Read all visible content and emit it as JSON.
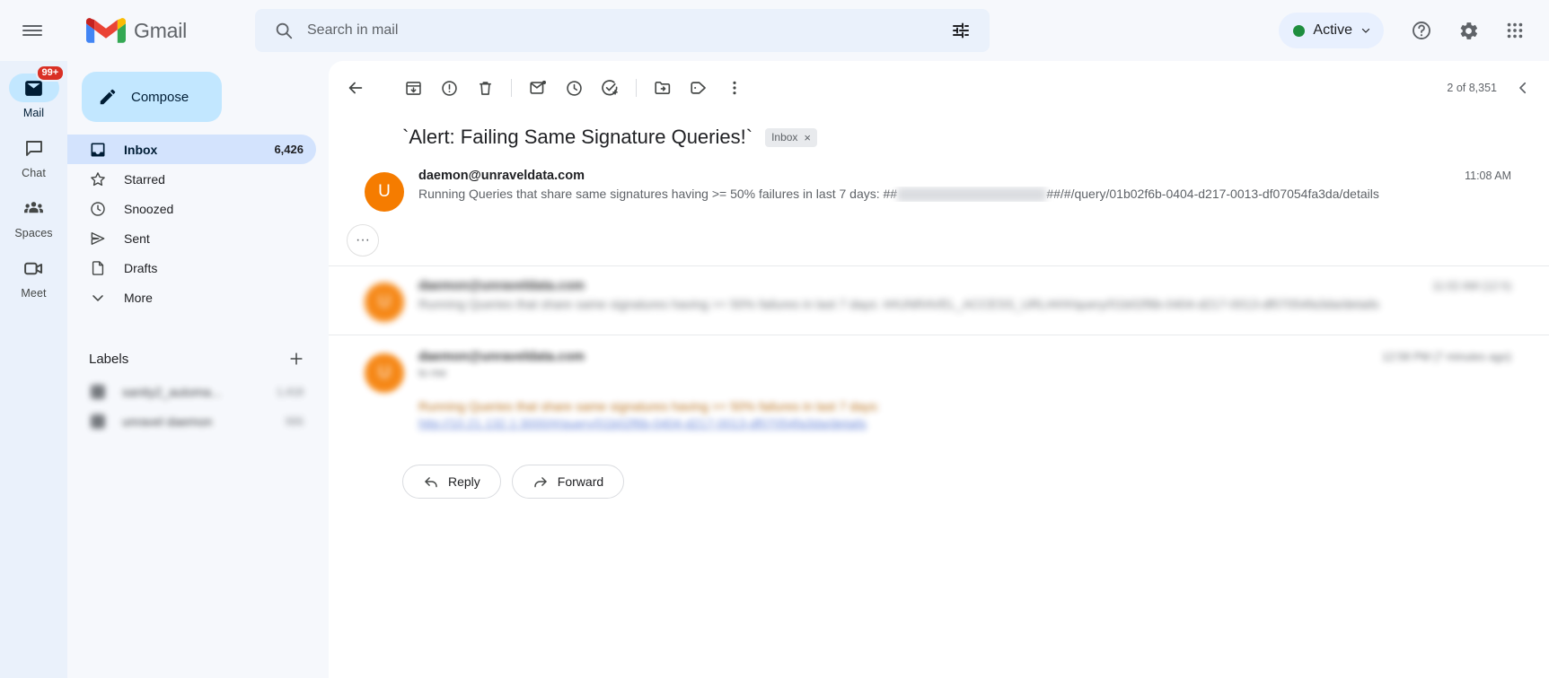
{
  "header": {
    "menu_tooltip": "Main menu",
    "brand": "Gmail",
    "search": {
      "placeholder": "Search in mail",
      "value": ""
    },
    "status": {
      "label": "Active"
    }
  },
  "rail": {
    "items": [
      {
        "label": "Mail",
        "icon": "mail-icon",
        "badge": "99+",
        "active": true
      },
      {
        "label": "Chat",
        "icon": "chat-icon",
        "badge": "",
        "active": false
      },
      {
        "label": "Spaces",
        "icon": "spaces-icon",
        "badge": "",
        "active": false
      },
      {
        "label": "Meet",
        "icon": "meet-icon",
        "badge": "",
        "active": false
      }
    ]
  },
  "nav": {
    "compose_label": "Compose",
    "items": [
      {
        "label": "Inbox",
        "count": "6,426",
        "icon": "inbox-icon",
        "active": true
      },
      {
        "label": "Starred",
        "count": "",
        "icon": "star-icon",
        "active": false
      },
      {
        "label": "Snoozed",
        "count": "",
        "icon": "clock-icon",
        "active": false
      },
      {
        "label": "Sent",
        "count": "",
        "icon": "send-icon",
        "active": false
      },
      {
        "label": "Drafts",
        "count": "",
        "icon": "draft-icon",
        "active": false
      },
      {
        "label": "More",
        "count": "",
        "icon": "chevron-down-icon",
        "active": false
      }
    ],
    "labels_title": "Labels",
    "labels": [
      {
        "name": "sanity2_automa...",
        "count": "1,418"
      },
      {
        "name": "unravel daemon",
        "count": "555"
      }
    ]
  },
  "conversation": {
    "toolbar": {
      "back": "Back to Inbox",
      "archive": "Archive",
      "report_spam": "Report spam",
      "delete": "Delete",
      "mark_unread": "Mark as unread",
      "snooze": "Snooze",
      "add_to_tasks": "Add to tasks",
      "move_to": "Move to",
      "labels": "Labels",
      "more": "More"
    },
    "pager": {
      "text": "2 of 8,351"
    },
    "subject": "`Alert: Failing Same Signature Queries!`",
    "chip": {
      "label": "Inbox",
      "close": "×"
    },
    "messages": [
      {
        "sender": "daemon@unraveldata.com",
        "time": "11:08 AM",
        "snippet_prefix": "Running Queries that share same signatures having >= 50% failures in last 7 days: ##",
        "snippet_redacted": "UNRAVEL_ACCESS_URL",
        "snippet_suffix": "##/#/query/01b02f6b-0404-d217-0013-df07054fa3da/details",
        "blurred": false
      },
      {
        "sender": "daemon@unraveldata.com",
        "time": "11:02 AM (12 h)",
        "snippet_prefix": "Running Queries that share same signatures having >= 50% failures in last 7 days: ##UNRAVEL_ACCESS_URL##/#/query/01b02f6b-0404-d217-0013-df07054fa3da/details",
        "snippet_redacted": "",
        "snippet_suffix": "",
        "blurred": true
      }
    ],
    "expanded_message": {
      "sender": "daemon@unraveldata.com",
      "time": "12:58 PM (7 minutes ago)",
      "to_line": "to me",
      "body": "Running Queries that share same signatures having >= 50% failures in last 7 days:",
      "link": "http://10.21.132.1:3000/#/query/01b02f6b-0404-d217-0013-df07054fa3da/details"
    },
    "collapsed_indicator": "···",
    "actions": {
      "reply": "Reply",
      "forward": "Forward"
    }
  },
  "colors": {
    "accent": "#c2e7ff",
    "badge": "#d93025",
    "status_green": "#1e8e3e",
    "avatar": "#f57c00"
  }
}
